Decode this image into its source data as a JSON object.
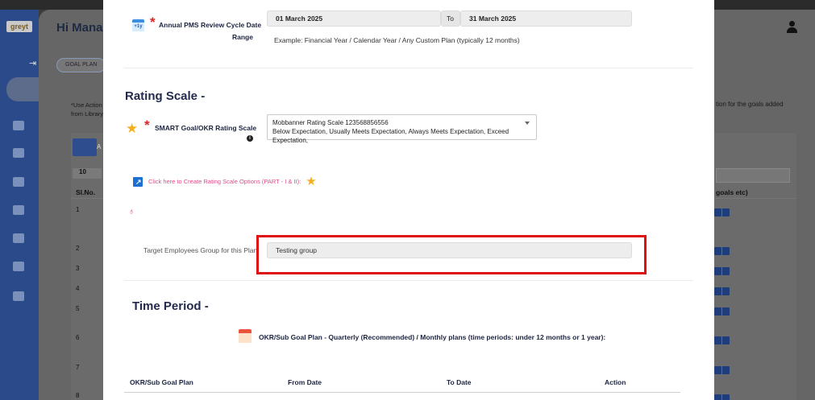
{
  "app": {
    "logo": "greyt",
    "greeting": "Hi Manag",
    "goal_plan_tab": "GOAL PLAN",
    "note_left": "*Use Action from Library",
    "note_right": "tion for the goals added",
    "add_label": "A",
    "show_count": "10",
    "col_slno": "Sl.No.",
    "col_goals": "goals etc)",
    "row_numbers": [
      "1",
      "2",
      "3",
      "4",
      "5",
      "6",
      "7",
      "8"
    ]
  },
  "modal": {
    "cycle": {
      "label": "Annual PMS Review Cycle Date Range",
      "label_line1": "Annual PMS Review Cycle Date",
      "label_line2": "Range",
      "icon_text": "+1y",
      "from": "01 March 2025",
      "to_label": "To",
      "to": "31 March 2025",
      "hint": "Example: Financial Year / Calendar Year / Any Custom Plan (typically 12 months)"
    },
    "rating": {
      "section_title": "Rating Scale -",
      "label": "SMART Goal/OKR Rating Scale",
      "selected_line1": "Mobbanner Rating Scale 123568856556",
      "selected_line2": "Below Expectation, Usually Meets Expectation, Always Meets Expectation, Exceed Expectation,",
      "create_link": "Click here to Create Rating Scale Options (PART - I & II):"
    },
    "target": {
      "label": "Target Employees Group for this Plan",
      "value": "Testing group"
    },
    "time_period": {
      "section_title": "Time Period -",
      "sub_label": "OKR/Sub Goal Plan - Quarterly (Recommended) / Monthly plans (time periods: under 12 months or 1 year):",
      "columns": [
        "OKR/Sub Goal Plan",
        "From Date",
        "To Date",
        "Action"
      ]
    }
  },
  "colors": {
    "accent": "#2a4a8a",
    "required": "#e02424",
    "link": "#e0498a",
    "highlight": "#e01010",
    "title": "#232a4d"
  }
}
